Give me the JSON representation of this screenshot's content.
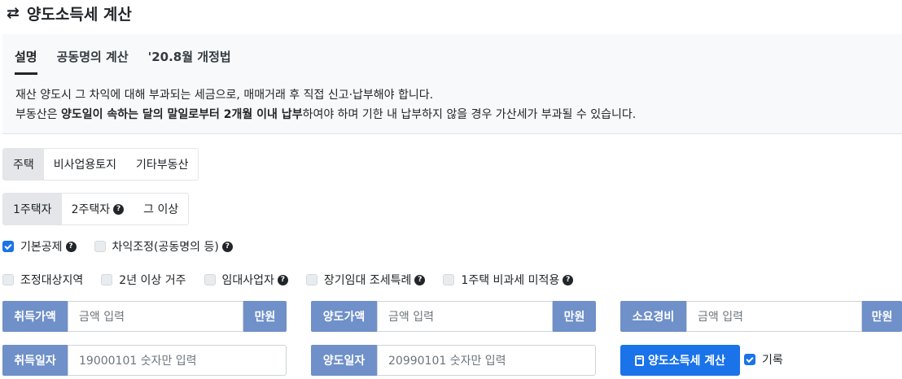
{
  "header": {
    "icon": "swap-arrows-icon",
    "title": "양도소득세 계산"
  },
  "info": {
    "tabs": [
      {
        "label": "설명",
        "active": true
      },
      {
        "label": "공동명의 계산",
        "active": false
      },
      {
        "label": "'20.8월 개정법",
        "active": false
      }
    ],
    "line1": "재산 양도시 그 차익에 대해 부과되는 세금으로, 매매거래 후 직접 신고·납부해야 합니다.",
    "line2_prefix": "부동산은 ",
    "line2_bold": "양도일이 속하는 달의 말일로부터 2개월 이내 납부",
    "line2_suffix": "하여야 하며 기한 내 납부하지 않을 경우 가산세가 부과될 수 있습니다."
  },
  "property_types": [
    {
      "label": "주택",
      "active": true
    },
    {
      "label": "비사업용토지",
      "active": false
    },
    {
      "label": "기타부동산",
      "active": false
    }
  ],
  "house_counts": [
    {
      "label": "1주택자",
      "active": true,
      "help": false
    },
    {
      "label": "2주택자",
      "active": false,
      "help": true
    },
    {
      "label": "그 이상",
      "active": false,
      "help": false
    }
  ],
  "options_row1": [
    {
      "label": "기본공제",
      "checked": true,
      "help": true
    },
    {
      "label": "차익조정(공동명의 등)",
      "checked": false,
      "help": true
    }
  ],
  "options_row2": [
    {
      "label": "조정대상지역",
      "checked": false,
      "help": false
    },
    {
      "label": "2년 이상 거주",
      "checked": false,
      "help": false
    },
    {
      "label": "임대사업자",
      "checked": false,
      "help": true
    },
    {
      "label": "장기임대 조세특례",
      "checked": false,
      "help": true
    },
    {
      "label": "1주택 비과세 미적용",
      "checked": false,
      "help": true
    }
  ],
  "inputs": {
    "acquisition_price": {
      "label": "취득가액",
      "placeholder": "금액 입력",
      "unit": "만원"
    },
    "transfer_price": {
      "label": "양도가액",
      "placeholder": "금액 입력",
      "unit": "만원"
    },
    "expenses": {
      "label": "소요경비",
      "placeholder": "금액 입력",
      "unit": "만원"
    },
    "acquisition_date": {
      "label": "취득일자",
      "placeholder": "19000101 숫자만 입력"
    },
    "transfer_date": {
      "label": "양도일자",
      "placeholder": "20990101 숫자만 입력"
    }
  },
  "calculate_button": {
    "label": "양도소득세 계산",
    "icon": "calculator-icon"
  },
  "record_checkbox": {
    "label": "기록",
    "checked": true
  },
  "help_icon_glyph": "?",
  "colors": {
    "primary": "#1a73e8",
    "input_label": "#6f90c8",
    "active_group": "#e4e6e9",
    "panel_bg": "#f8f9fa"
  }
}
